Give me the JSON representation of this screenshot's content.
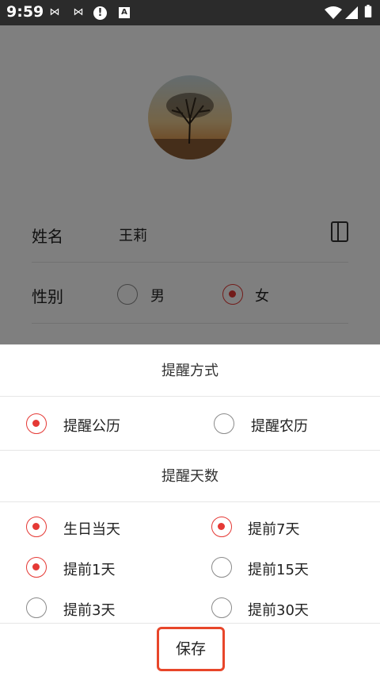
{
  "status_bar": {
    "time": "9:59",
    "icons": [
      "link-icon",
      "link-icon",
      "alert-icon",
      "a-box-icon",
      "wifi-icon",
      "signal-icon",
      "battery-icon"
    ]
  },
  "profile": {
    "name_label": "姓名",
    "name_value": "王莉",
    "gender_label": "性别",
    "gender_options": [
      {
        "label": "男",
        "selected": false
      },
      {
        "label": "女",
        "selected": true
      }
    ]
  },
  "sheet": {
    "reminder_method_title": "提醒方式",
    "reminder_methods": [
      {
        "label": "提醒公历",
        "selected": true
      },
      {
        "label": "提醒农历",
        "selected": false
      }
    ],
    "reminder_days_title": "提醒天数",
    "reminder_days": [
      {
        "label": "生日当天",
        "selected": true
      },
      {
        "label": "提前7天",
        "selected": true
      },
      {
        "label": "提前1天",
        "selected": true
      },
      {
        "label": "提前15天",
        "selected": false
      },
      {
        "label": "提前3天",
        "selected": false
      },
      {
        "label": "提前30天",
        "selected": false
      }
    ],
    "save_label": "保存"
  },
  "colors": {
    "accent": "#e53935",
    "highlight_border": "#e8462a",
    "status_bar": "#2b2b2b"
  }
}
